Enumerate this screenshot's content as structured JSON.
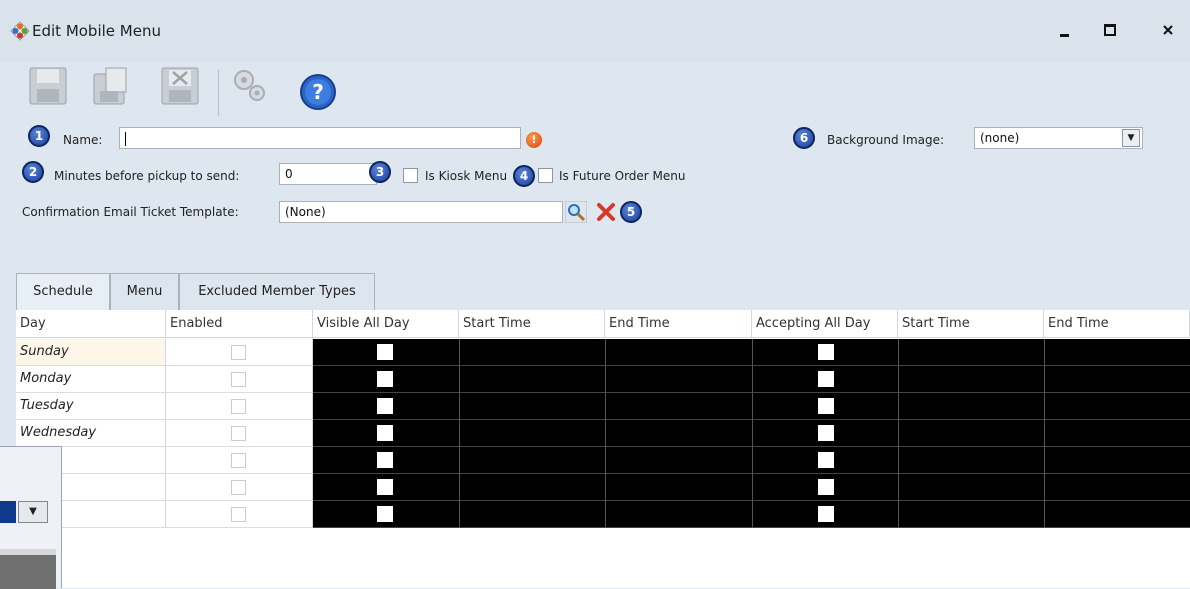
{
  "window": {
    "title": "Edit Mobile Menu",
    "controls": {
      "minimize": "‒",
      "maximize": "☐",
      "close": "×"
    }
  },
  "toolbar": {
    "buttons": [
      {
        "name": "save-icon"
      },
      {
        "name": "save-as-icon"
      },
      {
        "name": "delete-icon"
      },
      {
        "name": "settings-gears-icon"
      },
      {
        "name": "help-icon",
        "glyph": "?"
      }
    ]
  },
  "callouts": [
    "1",
    "2",
    "3",
    "4",
    "5",
    "6"
  ],
  "form": {
    "name_label": "Name:",
    "name_value": "",
    "minutes_label": "Minutes before pickup to send:",
    "minutes_value": "0",
    "kiosk_label": "Is Kiosk Menu",
    "future_order_label": "Is Future Order Menu",
    "template_label": "Confirmation Email Ticket Template:",
    "template_value": "(None)",
    "background_label": "Background Image:",
    "background_value": "(none)",
    "warning_glyph": "!"
  },
  "tabs": [
    "Schedule",
    "Menu",
    "Excluded Member Types"
  ],
  "schedule": {
    "columns": [
      "Day",
      "Enabled",
      "Visible All Day",
      "Start Time",
      "End Time",
      "Accepting All Day",
      "Start Time",
      "End Time"
    ],
    "rows": [
      {
        "day": "Sunday"
      },
      {
        "day": "Monday"
      },
      {
        "day": "Tuesday"
      },
      {
        "day": "Wednesday"
      },
      {
        "day": ""
      },
      {
        "day": ""
      },
      {
        "day": ""
      }
    ]
  },
  "colors": {
    "background": "#dee6ef",
    "callout": "#1c3f9c",
    "warning": "#d9420d",
    "grid_dark": "#000000",
    "highlight_cell": "#fdf7e9"
  }
}
